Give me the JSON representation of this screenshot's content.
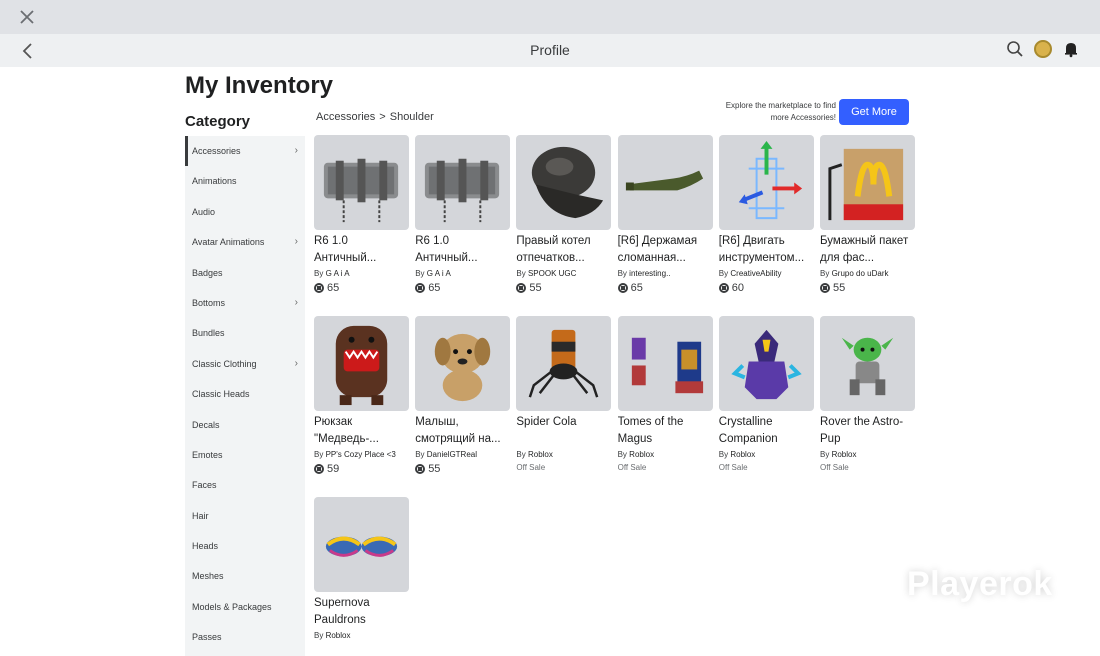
{
  "navbar": {
    "title": "Profile"
  },
  "page": {
    "title": "My Inventory",
    "category_title": "Category"
  },
  "sidebar": {
    "items": [
      {
        "label": "Accessories",
        "chevron": true,
        "active": true
      },
      {
        "label": "Animations",
        "chevron": false
      },
      {
        "label": "Audio",
        "chevron": false
      },
      {
        "label": "Avatar Animations",
        "chevron": true
      },
      {
        "label": "Badges",
        "chevron": false
      },
      {
        "label": "Bottoms",
        "chevron": true
      },
      {
        "label": "Bundles",
        "chevron": false
      },
      {
        "label": "Classic Clothing",
        "chevron": true
      },
      {
        "label": "Classic Heads",
        "chevron": false
      },
      {
        "label": "Decals",
        "chevron": false
      },
      {
        "label": "Emotes",
        "chevron": false
      },
      {
        "label": "Faces",
        "chevron": false
      },
      {
        "label": "Hair",
        "chevron": false
      },
      {
        "label": "Heads",
        "chevron": false
      },
      {
        "label": "Meshes",
        "chevron": false
      },
      {
        "label": "Models & Packages",
        "chevron": false
      },
      {
        "label": "Passes",
        "chevron": false
      }
    ]
  },
  "breadcrumb": {
    "parent": "Accessories",
    "separator": ">",
    "current": "Shoulder"
  },
  "promo": {
    "text": "Explore the marketplace to find more Accessories!",
    "button": "Get More"
  },
  "items": [
    {
      "name": "R6 1.0 Античный...",
      "by": "By",
      "creator": "G A i A",
      "price": "65",
      "art": "belt-icon"
    },
    {
      "name": "R6 1.0 Античный...",
      "by": "By",
      "creator": "G A i A",
      "price": "65",
      "art": "belt-icon"
    },
    {
      "name": "Правый котел отпечатков...",
      "by": "By",
      "creator": "SPOOK UGC",
      "price": "55",
      "art": "pauldron-icon"
    },
    {
      "name": "[R6] Держамая сломанная...",
      "by": "By",
      "creator": "interesting..",
      "price": "65",
      "art": "bottle-icon"
    },
    {
      "name": "[R6] Двигать инструментом...",
      "by": "By",
      "creator": "CreativeAbility",
      "price": "60",
      "art": "move-tool-icon"
    },
    {
      "name": "Бумажный пакет для фас...",
      "by": "By",
      "creator": "Grupo do uDark",
      "price": "55",
      "art": "paper-bag-icon"
    },
    {
      "name": "Рюкзак \"Медведь-...",
      "by": "By",
      "creator": "PP's Cozy Place <3",
      "price": "59",
      "art": "domo-backpack-icon"
    },
    {
      "name": "Малыш, смотрящий на...",
      "by": "By",
      "creator": "DanielGTReal",
      "price": "55",
      "art": "puppy-icon"
    },
    {
      "name": "Spider Cola",
      "by": "By",
      "creator": "Roblox",
      "offsale": "Off Sale",
      "art": "spider-cola-icon"
    },
    {
      "name": "Tomes of the Magus",
      "by": "By",
      "creator": "Roblox",
      "offsale": "Off Sale",
      "art": "tomes-icon"
    },
    {
      "name": "Crystalline Companion",
      "by": "By",
      "creator": "Roblox",
      "offsale": "Off Sale",
      "art": "crystal-companion-icon"
    },
    {
      "name": "Rover the Astro-Pup",
      "by": "By",
      "creator": "Roblox",
      "offsale": "Off Sale",
      "art": "astro-pup-icon"
    },
    {
      "name": "Supernova Pauldrons",
      "by": "By",
      "creator": "Roblox",
      "art": "supernova-pauldrons-icon"
    }
  ],
  "watermark": "Playerok",
  "colors": {
    "accent": "#335fff",
    "sidebar_bg": "#f2f4f5",
    "thumb_bg": "#d4d6da"
  }
}
